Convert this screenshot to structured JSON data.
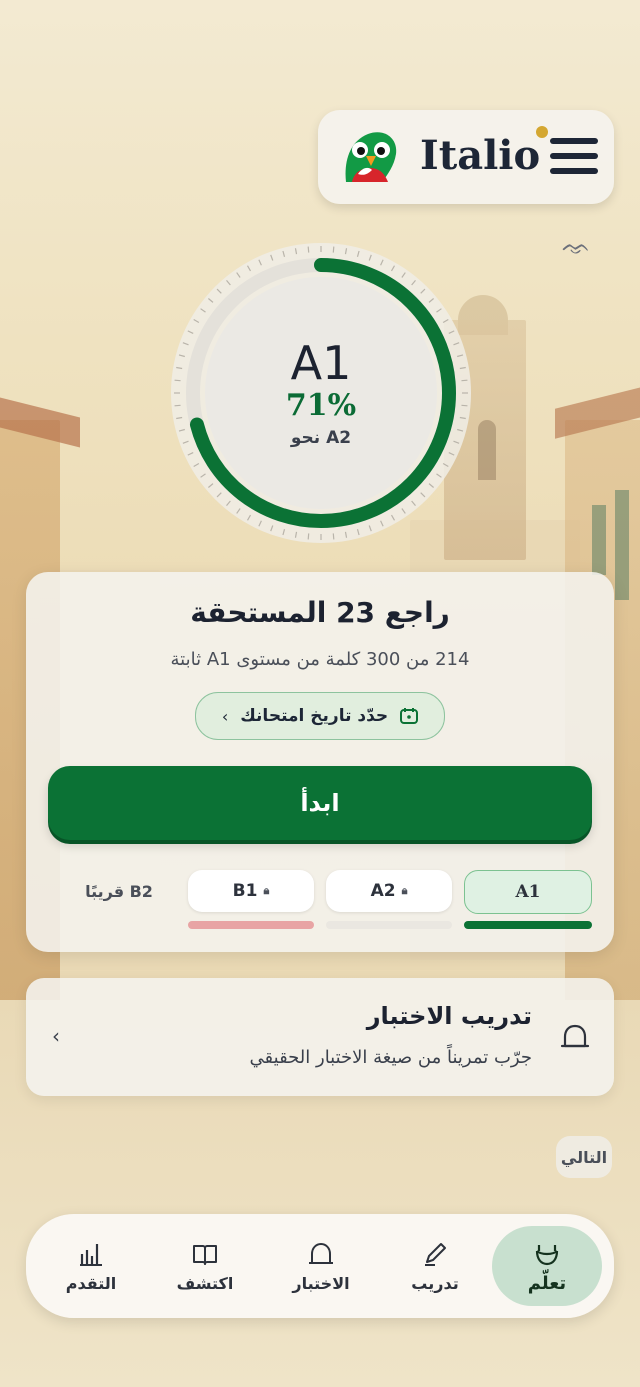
{
  "header": {
    "brand": "Italio",
    "logo_icon": "parrot-mascot-icon",
    "menu_icon": "hamburger-menu-icon",
    "notification_dot_color": "#d4a731"
  },
  "progress": {
    "current_level": "A1",
    "percent_text": "71%",
    "percent_value": 0.71,
    "target_label": "نحو A2",
    "ring_color": "#0b7235"
  },
  "review_card": {
    "title": "راجع 23 المستحقة",
    "subtitle": "214 من 300 كلمة من مستوى A1 ثابتة",
    "exam_button": "حدّد تاريخ امتحانك",
    "exam_icon": "calendar-icon",
    "start_button": "ابدأ",
    "levels": [
      {
        "label": "A1",
        "locked": false,
        "active": true,
        "progress": 1.0,
        "bar_color": "#0b7235"
      },
      {
        "label": "A2",
        "locked": true,
        "active": false,
        "progress": 0.0,
        "bar_color": "#eae7e1"
      },
      {
        "label": "B1",
        "locked": true,
        "active": false,
        "progress": 1.0,
        "bar_color": "#e8a4a4"
      },
      {
        "label": "B2 قريبًا",
        "locked": false,
        "active": false
      }
    ]
  },
  "practice_card": {
    "title": "تدريب الاختبار",
    "subtitle": "جرّب تمريناً من صيغة الاختبار الحقيقي",
    "icon": "bell-icon"
  },
  "next_chip": "التالي",
  "nav": {
    "items": [
      {
        "label": "تعلّم",
        "icon": "bowl-icon",
        "active": true
      },
      {
        "label": "تدريب",
        "icon": "pencil-icon",
        "active": false
      },
      {
        "label": "الاختبار",
        "icon": "bell-icon",
        "active": false
      },
      {
        "label": "اكتشف",
        "icon": "book-icon",
        "active": false
      },
      {
        "label": "التقدم",
        "icon": "bar-chart-icon",
        "active": false
      }
    ]
  },
  "colors": {
    "primary_green": "#0b7235",
    "light_green": "#dff1e3",
    "text_dark": "#1c2230"
  }
}
